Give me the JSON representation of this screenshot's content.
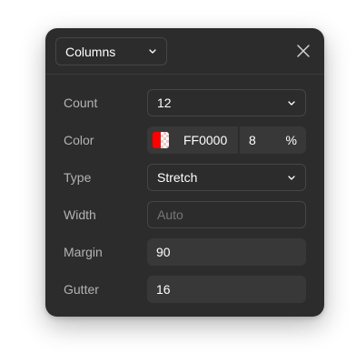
{
  "header": {
    "layout_type": "Columns",
    "close_icon": "close-icon",
    "dropdown_icon": "chevron-down-icon"
  },
  "fields": {
    "count": {
      "label": "Count",
      "value": "12"
    },
    "color": {
      "label": "Color",
      "hex": "FF0000",
      "opacity": "8",
      "unit": "%",
      "swatch_color": "#ff0000"
    },
    "type": {
      "label": "Type",
      "value": "Stretch"
    },
    "width": {
      "label": "Width",
      "placeholder": "Auto"
    },
    "margin": {
      "label": "Margin",
      "value": "90"
    },
    "gutter": {
      "label": "Gutter",
      "value": "16"
    }
  },
  "colors": {
    "panel_bg": "#2c2c2c",
    "field_bg": "#383838",
    "border": "#464646",
    "label": "#b3b3b3",
    "text": "#ffffff",
    "placeholder": "#777777"
  }
}
